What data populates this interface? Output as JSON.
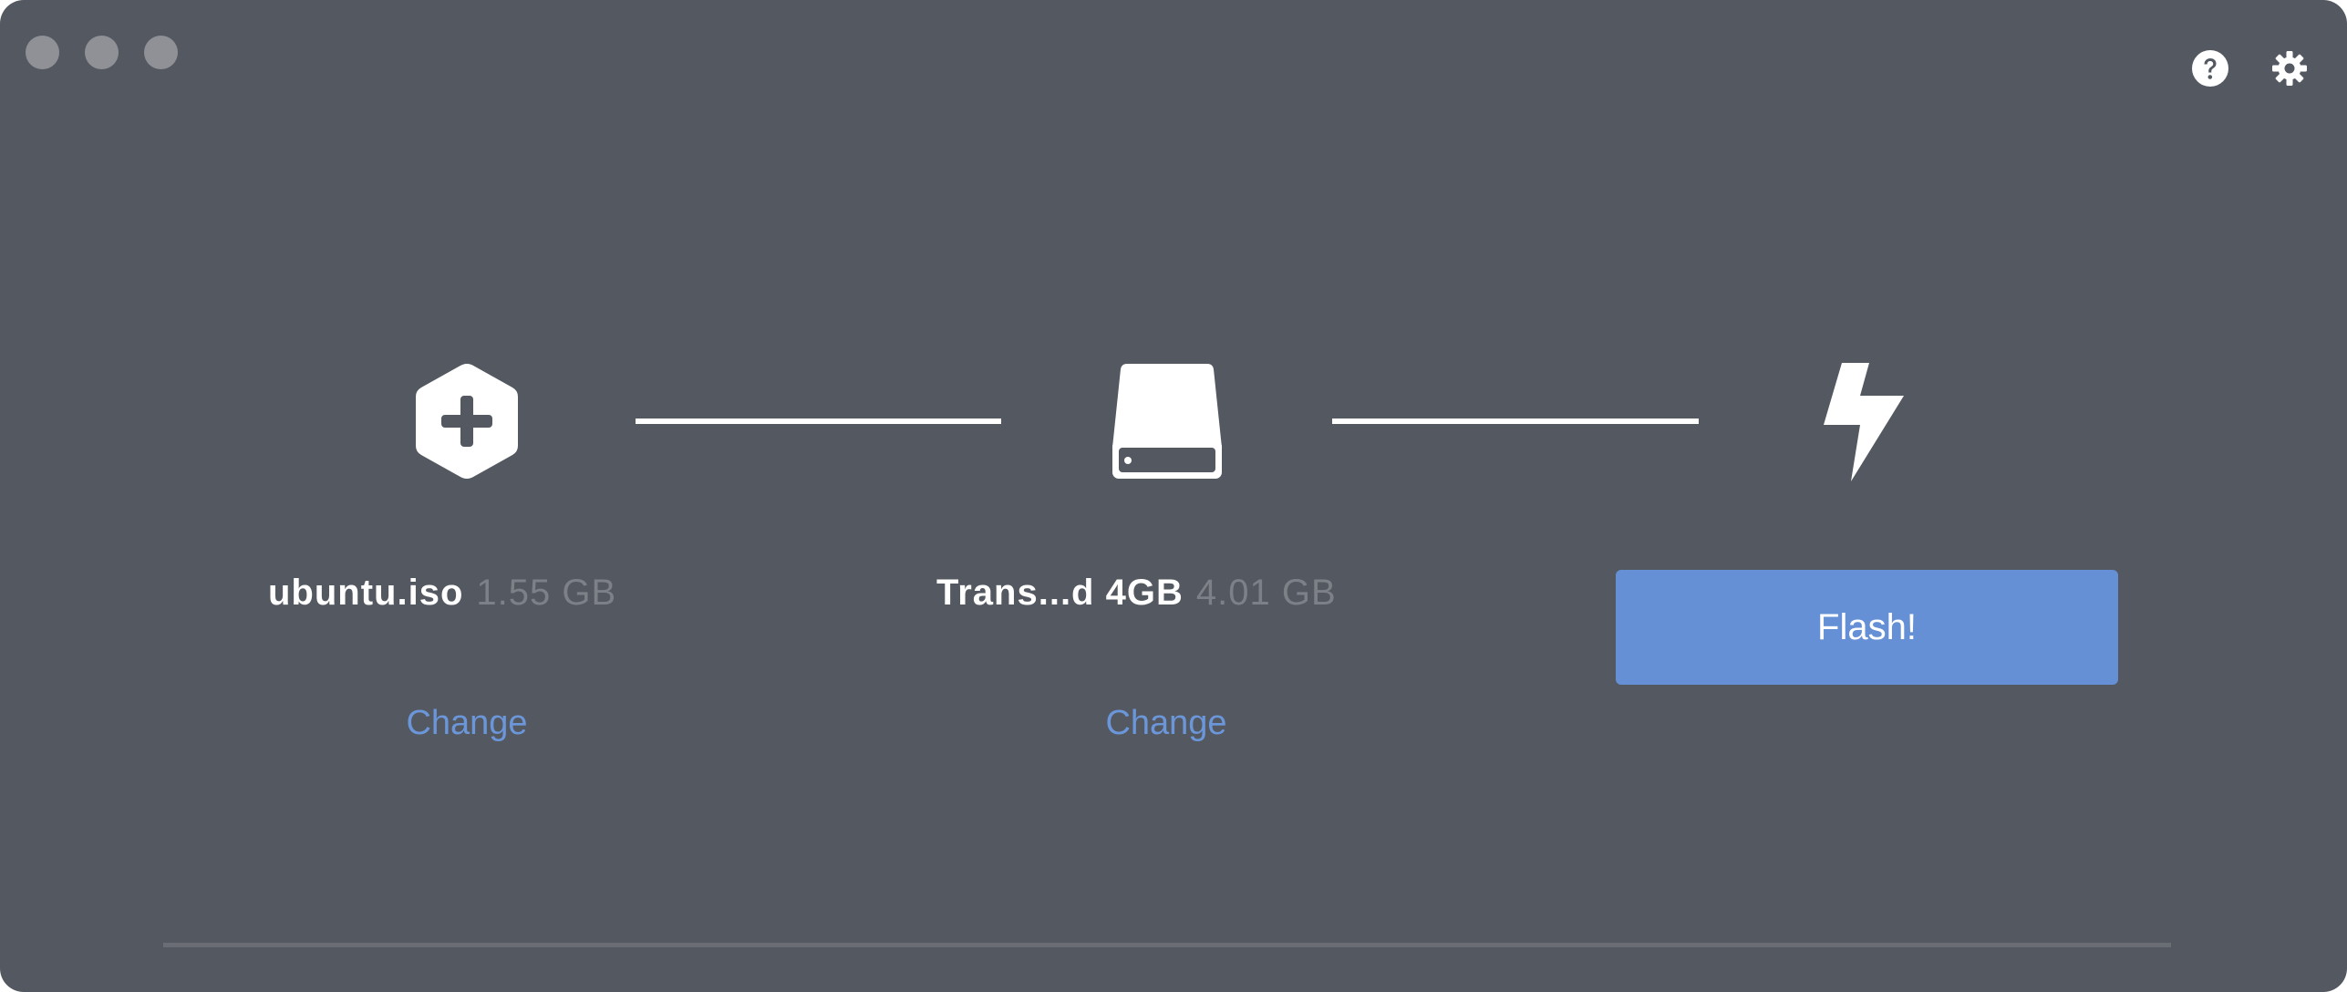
{
  "window": {
    "traffic_lights": [
      "close",
      "minimize",
      "zoom"
    ]
  },
  "toolbar": {
    "help_icon": "help-icon",
    "settings_icon": "gear-icon"
  },
  "steps": {
    "image": {
      "icon": "add-image-hexagon-icon",
      "name": "ubuntu.iso",
      "size": "1.55 GB",
      "change_label": "Change"
    },
    "drive": {
      "icon": "drive-icon",
      "name": "Trans...d 4GB",
      "size": "4.01 GB",
      "change_label": "Change"
    },
    "flash": {
      "icon": "lightning-icon",
      "button_label": "Flash!"
    }
  },
  "colors": {
    "background": "#545861",
    "accent": "#6690d6",
    "link": "#6b96d9",
    "muted_text": "#7d8087"
  }
}
